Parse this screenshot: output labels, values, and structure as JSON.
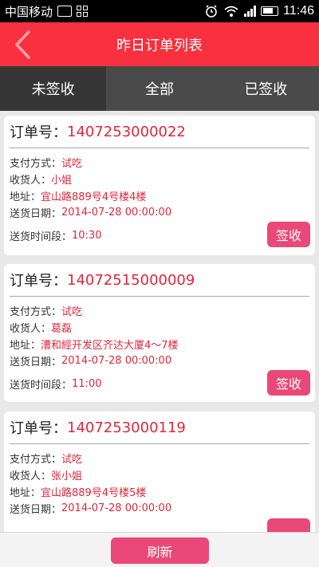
{
  "status_bar": {
    "carrier": "中国移动",
    "time": "11:46",
    "icons": [
      "image-icon",
      "grid-icon",
      "alarm-icon",
      "wifi-icon",
      "signal-icon",
      "battery-icon"
    ]
  },
  "header": {
    "title": "昨日订单列表",
    "back_icon": "chevron-left-icon"
  },
  "tabs": [
    {
      "label": "未签收",
      "active": true
    },
    {
      "label": "全部",
      "active": false
    },
    {
      "label": "已签收",
      "active": false
    }
  ],
  "orders": [
    {
      "order_label": "订单号：",
      "order_no": "1407253000022",
      "payment_label": "支付方式：",
      "payment": "试吃",
      "receiver_label": "收货人：",
      "receiver": "小姐",
      "address_label": "地址：",
      "address": "宜山路889号4号楼4楼",
      "date_label": "送货日期：",
      "date": "2014-07-28 00:00:00",
      "slot_label": "送货时间段：",
      "slot": "10:30",
      "sign_label": "签收"
    },
    {
      "order_label": "订单号：",
      "order_no": "14072515000009",
      "payment_label": "支付方式：",
      "payment": "试吃",
      "receiver_label": "收货人：",
      "receiver": "葛磊",
      "address_label": "地址：",
      "address": "漕和經开发区齐达大厦4～7楼",
      "date_label": "送货日期：",
      "date": "2014-07-28 00:00:00",
      "slot_label": "送货时间段：",
      "slot": "11:00",
      "sign_label": "签收"
    },
    {
      "order_label": "订单号：",
      "order_no": "1407253000119",
      "payment_label": "支付方式：",
      "payment": "试吃",
      "receiver_label": "收货人：",
      "receiver": "张小姐",
      "address_label": "地址：",
      "address": "宜山路889号4号楼5楼",
      "date_label": "送货日期：",
      "date": "2014-07-28 00:00:00"
    }
  ],
  "footer": {
    "refresh_label": "刷新"
  },
  "colors": {
    "header": "#f8303f",
    "accent_text": "#e0273b",
    "button": "#e94878",
    "tab_active": "#363636",
    "tab_inactive": "#4a4a4a"
  }
}
